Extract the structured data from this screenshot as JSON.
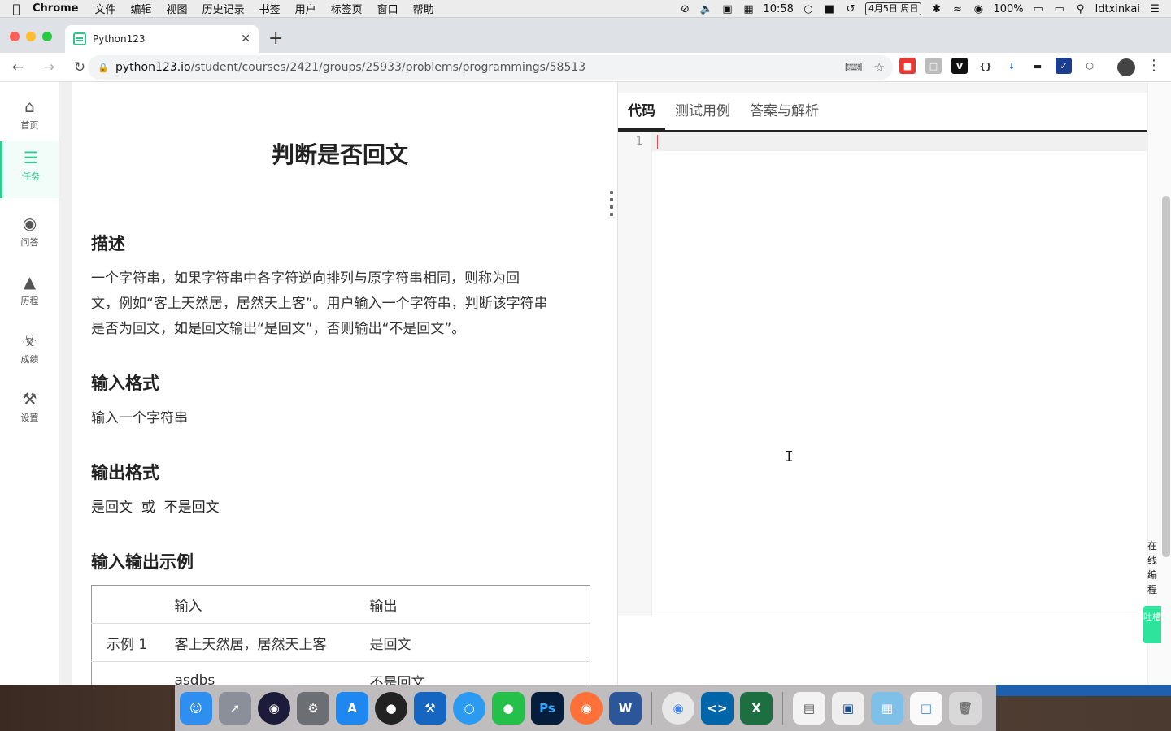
{
  "menubar": {
    "app_name": "Chrome",
    "menus": [
      "文件",
      "编辑",
      "视图",
      "历史记录",
      "书签",
      "用户",
      "标签页",
      "窗口",
      "帮助"
    ],
    "time": "10:58",
    "date": "4月5日 周日",
    "battery": "100%",
    "username": "ldtxinkai"
  },
  "browser": {
    "tab_title": "Python123",
    "url_host": "python123.io",
    "url_path": "/student/courses/2421/groups/25933/problems/programmings/58513"
  },
  "sidebar": {
    "items": [
      {
        "label": "首页",
        "icon": "home-icon"
      },
      {
        "label": "任务",
        "icon": "tasks-icon"
      },
      {
        "label": "问答",
        "icon": "chat-icon"
      },
      {
        "label": "历程",
        "icon": "tree-icon"
      },
      {
        "label": "成绩",
        "icon": "trophy-icon"
      },
      {
        "label": "设置",
        "icon": "wrench-icon"
      }
    ],
    "active_color": "#2ecc8f"
  },
  "problem": {
    "title": "判断是否回文",
    "description_heading": "描述",
    "description_lines": [
      "一个字符串，如果字符串中各字符逆向排列与原字符串相同，则称为回",
      "文，例如“客上天然居，居然天上客”。用户输入一个字符串，判断该字符串",
      "是否为回文，如是回文输出“是回文”，否则输出“不是回文”。"
    ],
    "input_heading": "输入格式",
    "input_text": "输入一个字符串",
    "output_heading": "输出格式",
    "output_text": "是回文  或  不是回文",
    "example_heading": "输入输出示例",
    "table": {
      "headers": [
        "",
        "输入",
        "输出"
      ],
      "rows": [
        [
          "示例 1",
          "客上天然居，居然天上客",
          "是回文"
        ],
        [
          "",
          "asdbs",
          "不是回文"
        ]
      ]
    }
  },
  "editor": {
    "tabs": [
      "代码",
      "测试用例",
      "答案与解析"
    ],
    "active_tab": "代码",
    "line_number": "1"
  },
  "side_float": {
    "label": "在线编程",
    "button": "吐槽",
    "accent": "#2ee39b"
  }
}
